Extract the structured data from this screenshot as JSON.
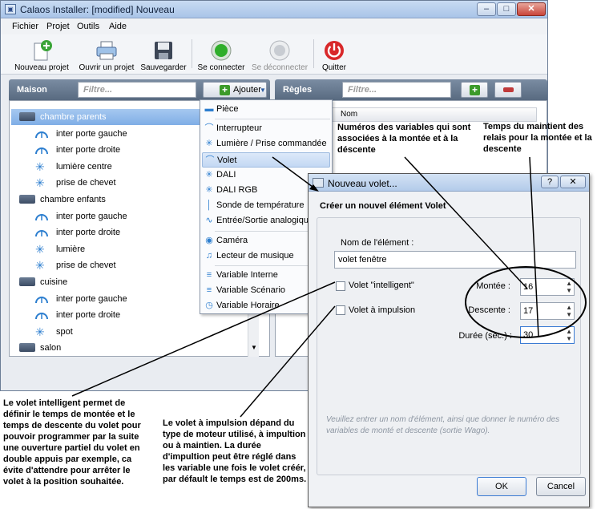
{
  "window": {
    "title": "Calaos Installer: [modified] Nouveau",
    "minimize": "–",
    "maximize": "□",
    "close": "✕"
  },
  "menu": [
    "Fichier",
    "Projet",
    "Outils",
    "Aide"
  ],
  "toolbar": {
    "new_project": "Nouveau projet",
    "open_project": "Ouvrir un projet",
    "save": "Sauvegarder",
    "connect": "Se connecter",
    "disconnect": "Se déconnecter",
    "quit": "Quitter"
  },
  "maison": {
    "title": "Maison",
    "filter_placeholder": "Filtre...",
    "add_label": "Ajouter",
    "tree": [
      {
        "type": "room",
        "label": "chambre parents",
        "selected": true
      },
      {
        "type": "volet",
        "label": "inter porte gauche"
      },
      {
        "type": "volet",
        "label": "inter porte droite"
      },
      {
        "type": "light",
        "label": "lumière centre"
      },
      {
        "type": "light",
        "label": "prise de chevet"
      },
      {
        "type": "room",
        "label": "chambre enfants"
      },
      {
        "type": "volet",
        "label": "inter porte gauche"
      },
      {
        "type": "volet",
        "label": "inter porte droite"
      },
      {
        "type": "light",
        "label": "lumière"
      },
      {
        "type": "light",
        "label": "prise de chevet"
      },
      {
        "type": "room",
        "label": "cuisine"
      },
      {
        "type": "volet",
        "label": "inter porte gauche"
      },
      {
        "type": "volet",
        "label": "inter porte droite"
      },
      {
        "type": "light",
        "label": "spot"
      },
      {
        "type": "room",
        "label": "salon"
      }
    ]
  },
  "regles": {
    "title": "Règles",
    "filter_placeholder": "Filtre...",
    "column_nom": "Nom"
  },
  "dropdown": {
    "items": [
      {
        "label": "Pièce",
        "icon": "room-icon"
      },
      {
        "label": "Interrupteur",
        "icon": "switch-icon"
      },
      {
        "label": "Lumière / Prise commandée",
        "icon": "light-icon"
      },
      {
        "label": "Volet",
        "icon": "shutter-icon",
        "highlighted": true
      },
      {
        "label": "DALI",
        "icon": "light-icon"
      },
      {
        "label": "DALI RGB",
        "icon": "light-icon"
      },
      {
        "label": "Sonde de température",
        "icon": "thermometer-icon"
      },
      {
        "label": "Entrée/Sortie analogique",
        "icon": "analog-icon"
      },
      {
        "label": "Caméra",
        "icon": "camera-icon"
      },
      {
        "label": "Lecteur de musique",
        "icon": "music-icon"
      },
      {
        "label": "Variable Interne",
        "icon": "variable-icon"
      },
      {
        "label": "Variable Scénario",
        "icon": "variable-icon"
      },
      {
        "label": "Variable Horaire",
        "icon": "clock-icon"
      }
    ]
  },
  "dialog": {
    "title": "Nouveau volet...",
    "help": "?",
    "close": "✕",
    "heading": "Créer un nouvel élément Volet",
    "name_label": "Nom de l'élément :",
    "name_value": "volet fenêtre",
    "intelligent_label": "Volet \"intelligent\"",
    "impulsion_label": "Volet à impulsion",
    "montee_label": "Montée :",
    "montee_value": "16",
    "descente_label": "Descente :",
    "descente_value": "17",
    "duree_label": "Durée (sec.) :",
    "duree_value": "30",
    "hint": "Veuillez entrer un nom d'élément, ainsi que donner le numéro des variables de monté et descente (sortie Wago).",
    "ok": "OK",
    "cancel": "Cancel"
  },
  "annotations": {
    "variables": "Numéros des variables qui sont associées à la montée et à la déscente",
    "relais": "Temps du maintient des relais pour la montée et la descente",
    "intelligent": "Le volet intelligent permet de définir le temps de montée et le temps de descente du volet pour pouvoir programmer par la suite une ouverture partiel du volet en double appuis par exemple, ca évite d'attendre pour arrêter le volet à la position souhaitée.",
    "impulsion": "Le volet à impulsion dépand du type de moteur utilisé, à impultion ou à maintien. La durée d'impultion peut être réglé dans les variable une fois le volet créér, par défault le temps est de 200ms."
  }
}
